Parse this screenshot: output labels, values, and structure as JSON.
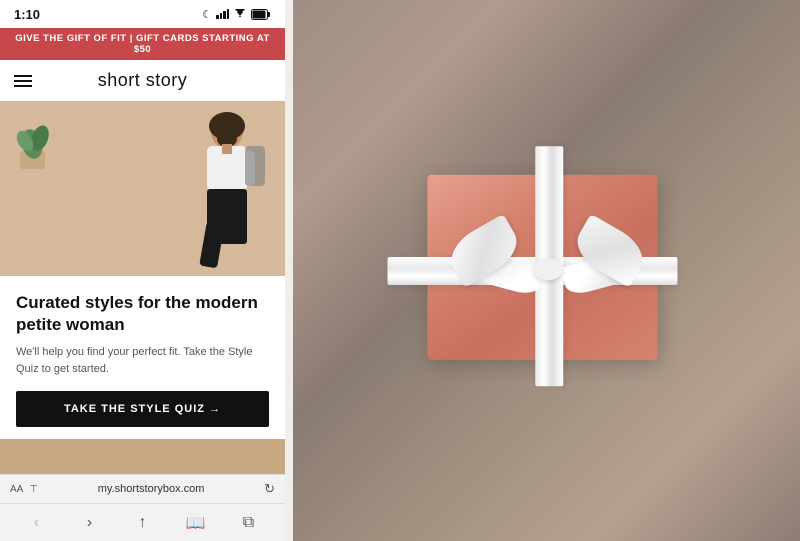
{
  "phone": {
    "status": {
      "time": "1:10",
      "moon": "☾",
      "wifi": "WiFi",
      "battery": "🔋"
    },
    "promo_banner": "GIVE THE GIFT OF FIT | GIFT CARDS STARTING AT $50",
    "nav": {
      "title": "short story"
    },
    "hero": {
      "alt": "Woman in white top and black pants"
    },
    "card": {
      "heading": "Curated styles for the modern petite woman",
      "subtext": "We'll help you find your perfect fit. Take the Style Quiz to get started.",
      "cta_label": "TAKE THE STYLE QUIZ →"
    },
    "browser": {
      "aa": "AA",
      "translate_icon": "⊤",
      "url": "my.shortstorybox.com",
      "refresh_icon": "↻"
    },
    "toolbar": {
      "back": "‹",
      "forward": "›",
      "share": "↑",
      "bookmarks": "📖",
      "tabs": "⧉"
    }
  },
  "gift_box": {
    "alt": "Pink gift box with white ribbon and bow on wooden surface"
  }
}
